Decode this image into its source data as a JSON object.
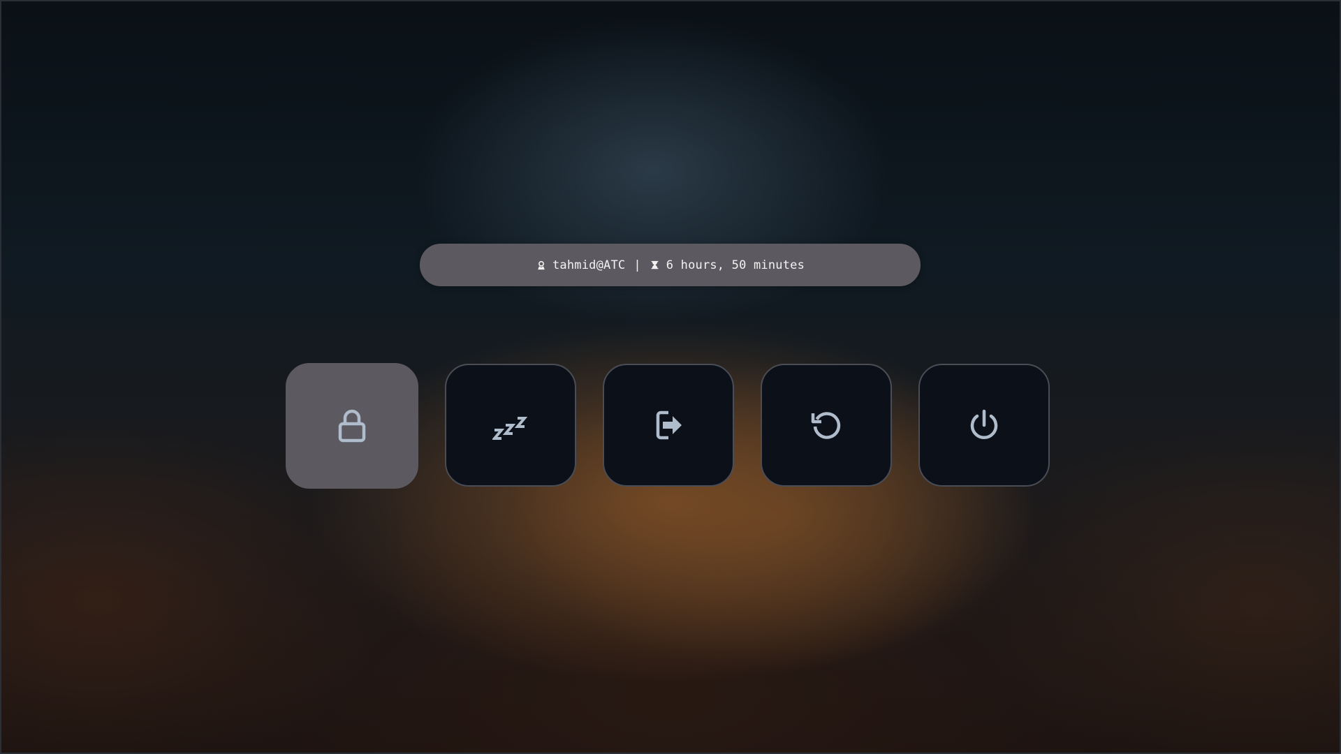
{
  "info": {
    "user_icon": "user-icon",
    "user": "tahmid@ATC",
    "separator": "|",
    "uptime_icon": "hourglass-icon",
    "uptime": "6 hours, 50 minutes"
  },
  "actions": [
    {
      "id": "lock",
      "icon": "lock-icon",
      "selected": true
    },
    {
      "id": "suspend",
      "icon": "sleep-icon",
      "selected": false
    },
    {
      "id": "logout",
      "icon": "logout-icon",
      "selected": false
    },
    {
      "id": "reboot",
      "icon": "reboot-icon",
      "selected": false
    },
    {
      "id": "shutdown",
      "icon": "power-icon",
      "selected": false
    }
  ],
  "colors": {
    "icon": "#aebccb",
    "button_bg": "#0c1019",
    "button_selected_bg": "#5c5a60",
    "bar_bg": "#5c5a60",
    "text": "#f2f2f2"
  }
}
